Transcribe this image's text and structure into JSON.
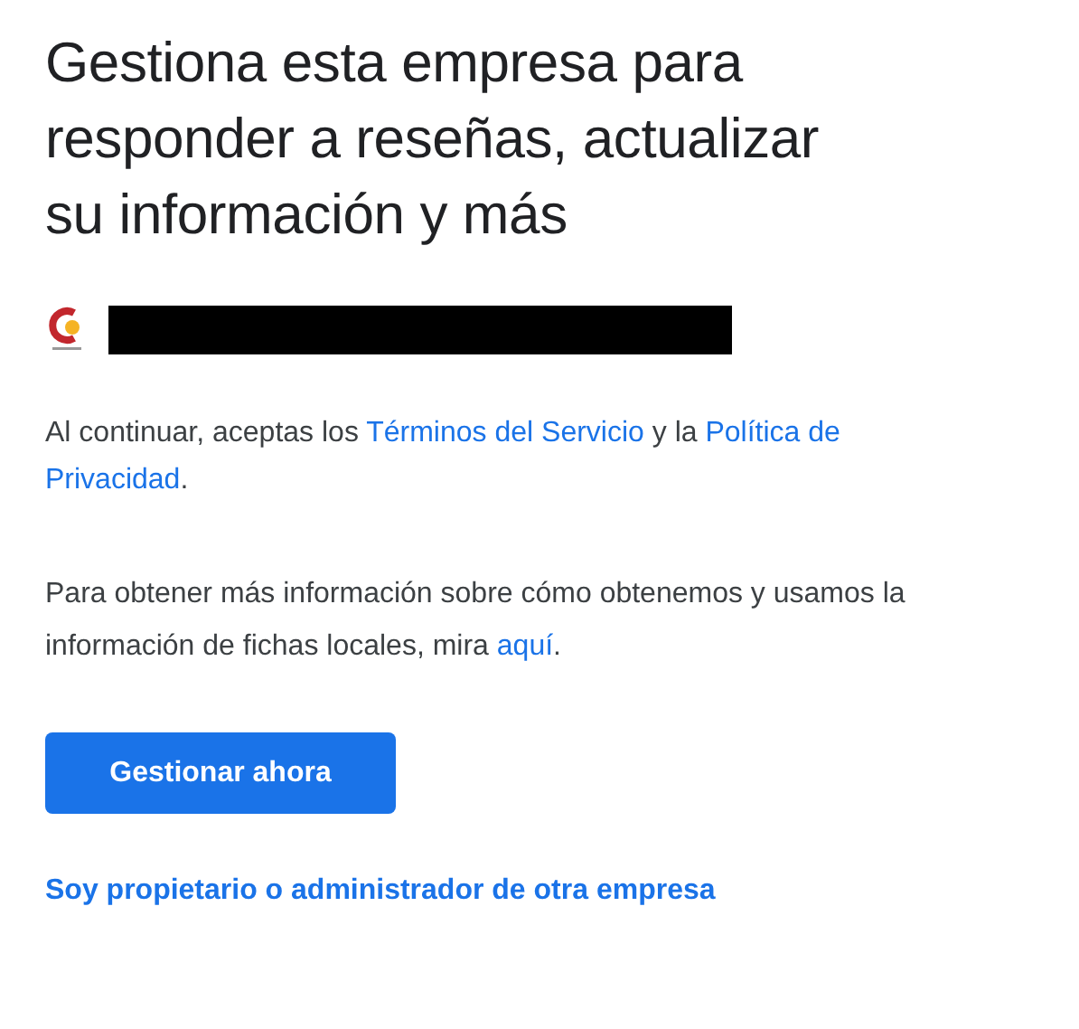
{
  "heading": "Gestiona esta empresa para responder a reseñas, actualizar su información y más",
  "business": {
    "name_redacted": true
  },
  "terms": [
    {
      "kind": "text",
      "text": "Al continuar, aceptas los "
    },
    {
      "kind": "link",
      "text": "Términos del Servicio"
    },
    {
      "kind": "text",
      "text": " y la "
    },
    {
      "kind": "link",
      "text": "Política de"
    },
    {
      "kind": "break"
    },
    {
      "kind": "link",
      "text": "Privacidad"
    },
    {
      "kind": "text",
      "text": "."
    }
  ],
  "info": [
    {
      "kind": "text",
      "text": "Para obtener más información sobre cómo obtenemos y usamos la información de fichas locales, mira "
    },
    {
      "kind": "link",
      "text": "aquí"
    },
    {
      "kind": "text",
      "text": "."
    }
  ],
  "primary_button": "Gestionar ahora",
  "secondary_link": "Soy propietario o administrador de otra empresa"
}
